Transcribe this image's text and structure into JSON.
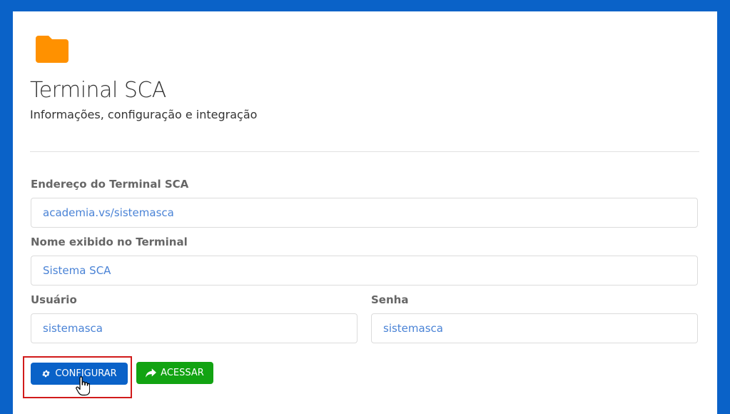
{
  "header": {
    "title": "Terminal SCA",
    "subtitle": "Informações, configuração e integração",
    "icon": "folder-icon",
    "icon_color": "#ff9100"
  },
  "form": {
    "endereco": {
      "label": "Endereço do Terminal SCA",
      "value": "academia.vs/sistemasca"
    },
    "nome": {
      "label": "Nome exibido no Terminal",
      "value": "Sistema SCA"
    },
    "usuario": {
      "label": "Usuário",
      "value": "sistemasca"
    },
    "senha": {
      "label": "Senha",
      "value": "sistemasca"
    }
  },
  "actions": {
    "configurar": {
      "label": "CONFIGURAR",
      "icon": "gear-icon",
      "color": "#0a62c8"
    },
    "acessar": {
      "label": "ACESSAR",
      "icon": "share-arrow-icon",
      "color": "#12a312"
    }
  },
  "colors": {
    "background": "#0a62c8",
    "highlight": "#d11b1b"
  }
}
